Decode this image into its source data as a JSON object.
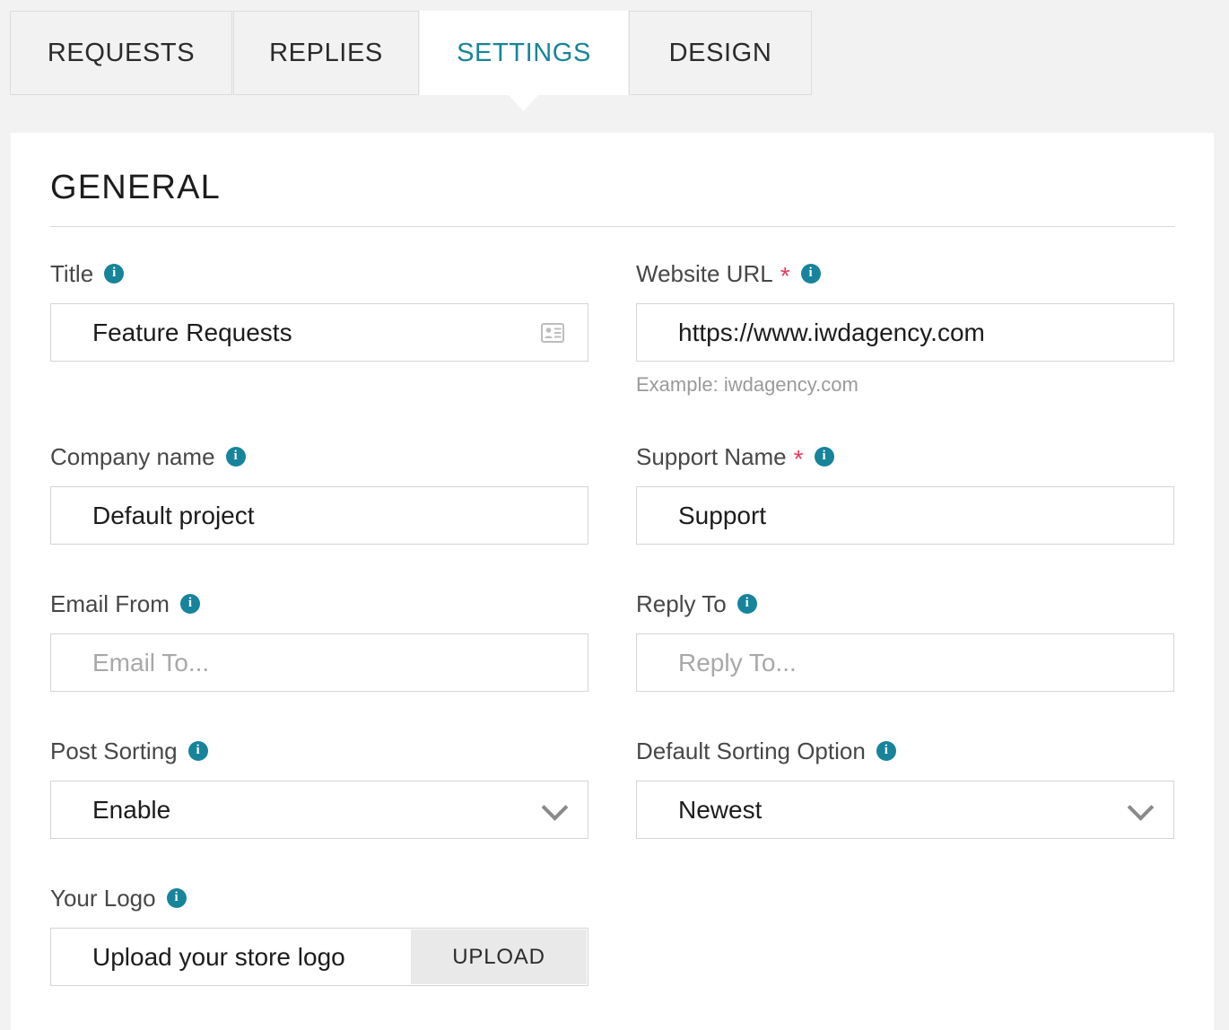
{
  "colors": {
    "accent_teal": "#17849b",
    "required_red": "#e8395c",
    "page_background": "#f2f2f2",
    "card_background": "#ffffff",
    "border_gray": "#d5d5d5",
    "label_gray": "#474747",
    "placeholder_gray": "#a8a8a8",
    "upload_button_gray": "#e9e9e9"
  },
  "tabs": [
    {
      "label": "REQUESTS",
      "active": false
    },
    {
      "label": "REPLIES",
      "active": false
    },
    {
      "label": "SETTINGS",
      "active": true
    },
    {
      "label": "DESIGN",
      "active": false
    }
  ],
  "panel": {
    "section_title": "GENERAL",
    "fields": {
      "title": {
        "label": "Title",
        "value": "Feature Requests",
        "icon": "contact-card-icon",
        "required": false
      },
      "website_url": {
        "label": "Website URL",
        "required_marker": "*",
        "value": "https://www.iwdagency.com",
        "helper": "Example: iwdagency.com",
        "required": true
      },
      "company_name": {
        "label": "Company name",
        "value": "Default project",
        "required": false
      },
      "support_name": {
        "label": "Support Name",
        "required_marker": "*",
        "value": "Support",
        "required": true
      },
      "email_from": {
        "label": "Email From",
        "value": "",
        "placeholder": "Email To...",
        "required": false
      },
      "reply_to": {
        "label": "Reply To",
        "value": "",
        "placeholder": "Reply To...",
        "required": false
      },
      "post_sorting": {
        "label": "Post Sorting",
        "selected": "Enable",
        "required": false
      },
      "default_sorting_option": {
        "label": "Default Sorting Option",
        "selected": "Newest",
        "required": false
      },
      "your_logo": {
        "label": "Your Logo",
        "value": "Upload your store logo",
        "button_label": "UPLOAD",
        "required": false
      }
    }
  }
}
